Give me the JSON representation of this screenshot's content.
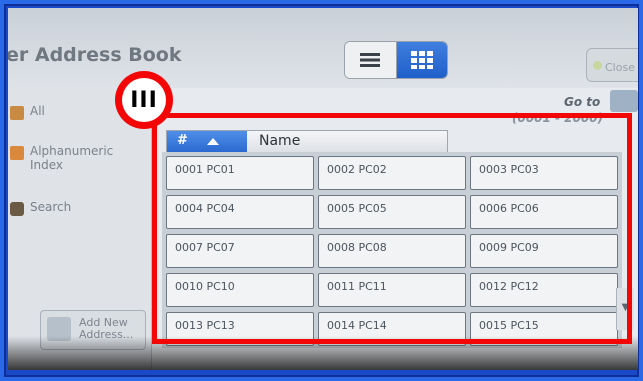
{
  "header": {
    "title": "er Address Book",
    "close_label": "Close",
    "view_list_icon": "list-view-icon",
    "view_grid_icon": "grid-view-icon"
  },
  "sidebar": {
    "items": [
      {
        "label": "All",
        "icon": "book-icon"
      },
      {
        "label": "Alphanumeric Index",
        "icon": "alpha-index-icon"
      },
      {
        "label": "Search",
        "icon": "binoculars-icon"
      }
    ],
    "add_button": "Add New Address..."
  },
  "main": {
    "goto_label": "Go to",
    "range": "(0001 - 2000)",
    "columns": {
      "hash": "#",
      "name": "Name"
    },
    "cells": [
      "0001 PC01",
      "0002 PC02",
      "0003 PC03",
      "0004 PC04",
      "0005 PC05",
      "0006 PC06",
      "0007 PC07",
      "0008 PC08",
      "0009 PC09",
      "0010 PC10",
      "0011 PC11",
      "0012 PC12",
      "0013 PC13",
      "0014 PC14",
      "0015 PC15"
    ],
    "scroll_down": "▼"
  },
  "annotation": {
    "label": "III",
    "color": "#f20606"
  },
  "colors": {
    "accent_blue": "#2a68cf",
    "frame_blue": "#1a49c8"
  }
}
